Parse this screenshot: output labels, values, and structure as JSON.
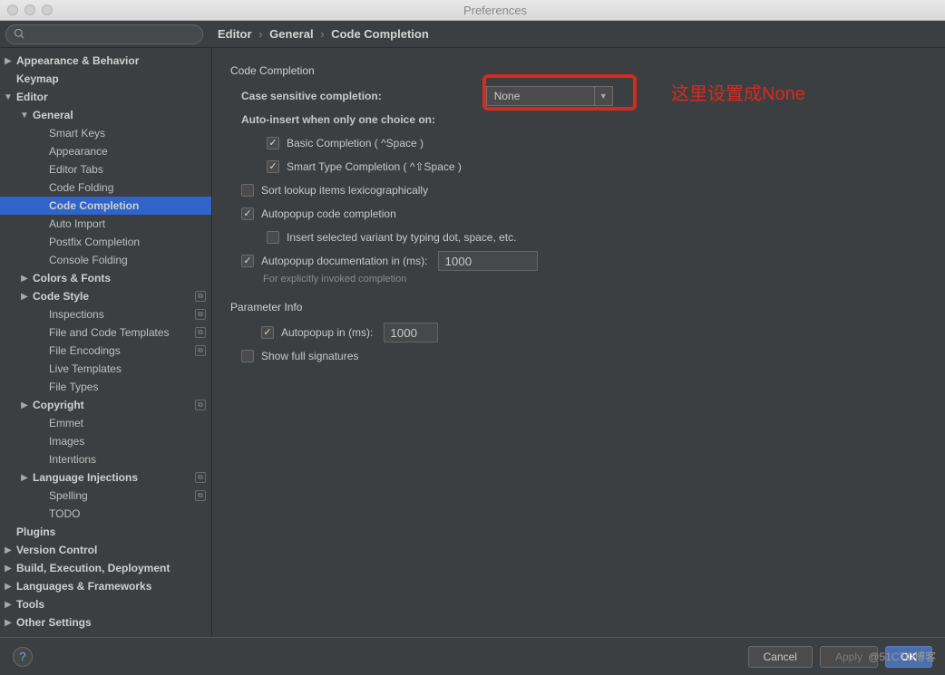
{
  "window": {
    "title": "Preferences"
  },
  "breadcrumb": {
    "a": "Editor",
    "b": "General",
    "c": "Code Completion"
  },
  "sidebar": {
    "items": [
      {
        "label": "Appearance & Behavior",
        "indent": 1,
        "arrow": "right",
        "bold": true
      },
      {
        "label": "Keymap",
        "indent": 1,
        "arrow": "",
        "bold": true
      },
      {
        "label": "Editor",
        "indent": 1,
        "arrow": "down",
        "bold": true
      },
      {
        "label": "General",
        "indent": 2,
        "arrow": "down",
        "bold": true
      },
      {
        "label": "Smart Keys",
        "indent": 3,
        "arrow": ""
      },
      {
        "label": "Appearance",
        "indent": 3,
        "arrow": ""
      },
      {
        "label": "Editor Tabs",
        "indent": 3,
        "arrow": ""
      },
      {
        "label": "Code Folding",
        "indent": 3,
        "arrow": ""
      },
      {
        "label": "Code Completion",
        "indent": 3,
        "arrow": "",
        "selected": true,
        "bold": true
      },
      {
        "label": "Auto Import",
        "indent": 3,
        "arrow": ""
      },
      {
        "label": "Postfix Completion",
        "indent": 3,
        "arrow": ""
      },
      {
        "label": "Console Folding",
        "indent": 3,
        "arrow": ""
      },
      {
        "label": "Colors & Fonts",
        "indent": 2,
        "arrow": "right",
        "bold": true
      },
      {
        "label": "Code Style",
        "indent": 2,
        "arrow": "right",
        "bold": true,
        "badge": true
      },
      {
        "label": "Inspections",
        "indent": 3,
        "arrow": "",
        "badge": true
      },
      {
        "label": "File and Code Templates",
        "indent": 3,
        "arrow": "",
        "badge": true
      },
      {
        "label": "File Encodings",
        "indent": 3,
        "arrow": "",
        "badge": true
      },
      {
        "label": "Live Templates",
        "indent": 3,
        "arrow": ""
      },
      {
        "label": "File Types",
        "indent": 3,
        "arrow": ""
      },
      {
        "label": "Copyright",
        "indent": 2,
        "arrow": "right",
        "bold": true,
        "badge": true
      },
      {
        "label": "Emmet",
        "indent": 3,
        "arrow": ""
      },
      {
        "label": "Images",
        "indent": 3,
        "arrow": ""
      },
      {
        "label": "Intentions",
        "indent": 3,
        "arrow": ""
      },
      {
        "label": "Language Injections",
        "indent": 2,
        "arrow": "right",
        "bold": true,
        "badge": true
      },
      {
        "label": "Spelling",
        "indent": 3,
        "arrow": "",
        "badge": true
      },
      {
        "label": "TODO",
        "indent": 3,
        "arrow": ""
      },
      {
        "label": "Plugins",
        "indent": 1,
        "arrow": "",
        "bold": true
      },
      {
        "label": "Version Control",
        "indent": 1,
        "arrow": "right",
        "bold": true
      },
      {
        "label": "Build, Execution, Deployment",
        "indent": 1,
        "arrow": "right",
        "bold": true
      },
      {
        "label": "Languages & Frameworks",
        "indent": 1,
        "arrow": "right",
        "bold": true
      },
      {
        "label": "Tools",
        "indent": 1,
        "arrow": "right",
        "bold": true
      },
      {
        "label": "Other Settings",
        "indent": 1,
        "arrow": "right",
        "bold": true
      }
    ]
  },
  "content": {
    "section1": "Code Completion",
    "case_sensitive_label": "Case sensitive completion:",
    "case_sensitive_value": "None",
    "auto_insert_label": "Auto-insert when only one choice on:",
    "basic_completion": "Basic Completion ( ^Space )",
    "smart_type_completion": "Smart Type Completion ( ^⇧Space )",
    "sort_lookup": "Sort lookup items lexicographically",
    "autopopup_code": "Autopopup code completion",
    "insert_selected": "Insert selected variant by typing dot, space, etc.",
    "autopopup_doc_label": "Autopopup documentation in (ms):",
    "autopopup_doc_value": "1000",
    "autopopup_doc_helper": "For explicitly invoked completion",
    "section2": "Parameter Info",
    "autopopup_in_label": "Autopopup in (ms):",
    "autopopup_in_value": "1000",
    "show_full_sig": "Show full signatures"
  },
  "annotation": {
    "text": "这里设置成None"
  },
  "footer": {
    "cancel": "Cancel",
    "apply": "Apply",
    "ok": "OK"
  },
  "watermark": "@51CTO博客"
}
